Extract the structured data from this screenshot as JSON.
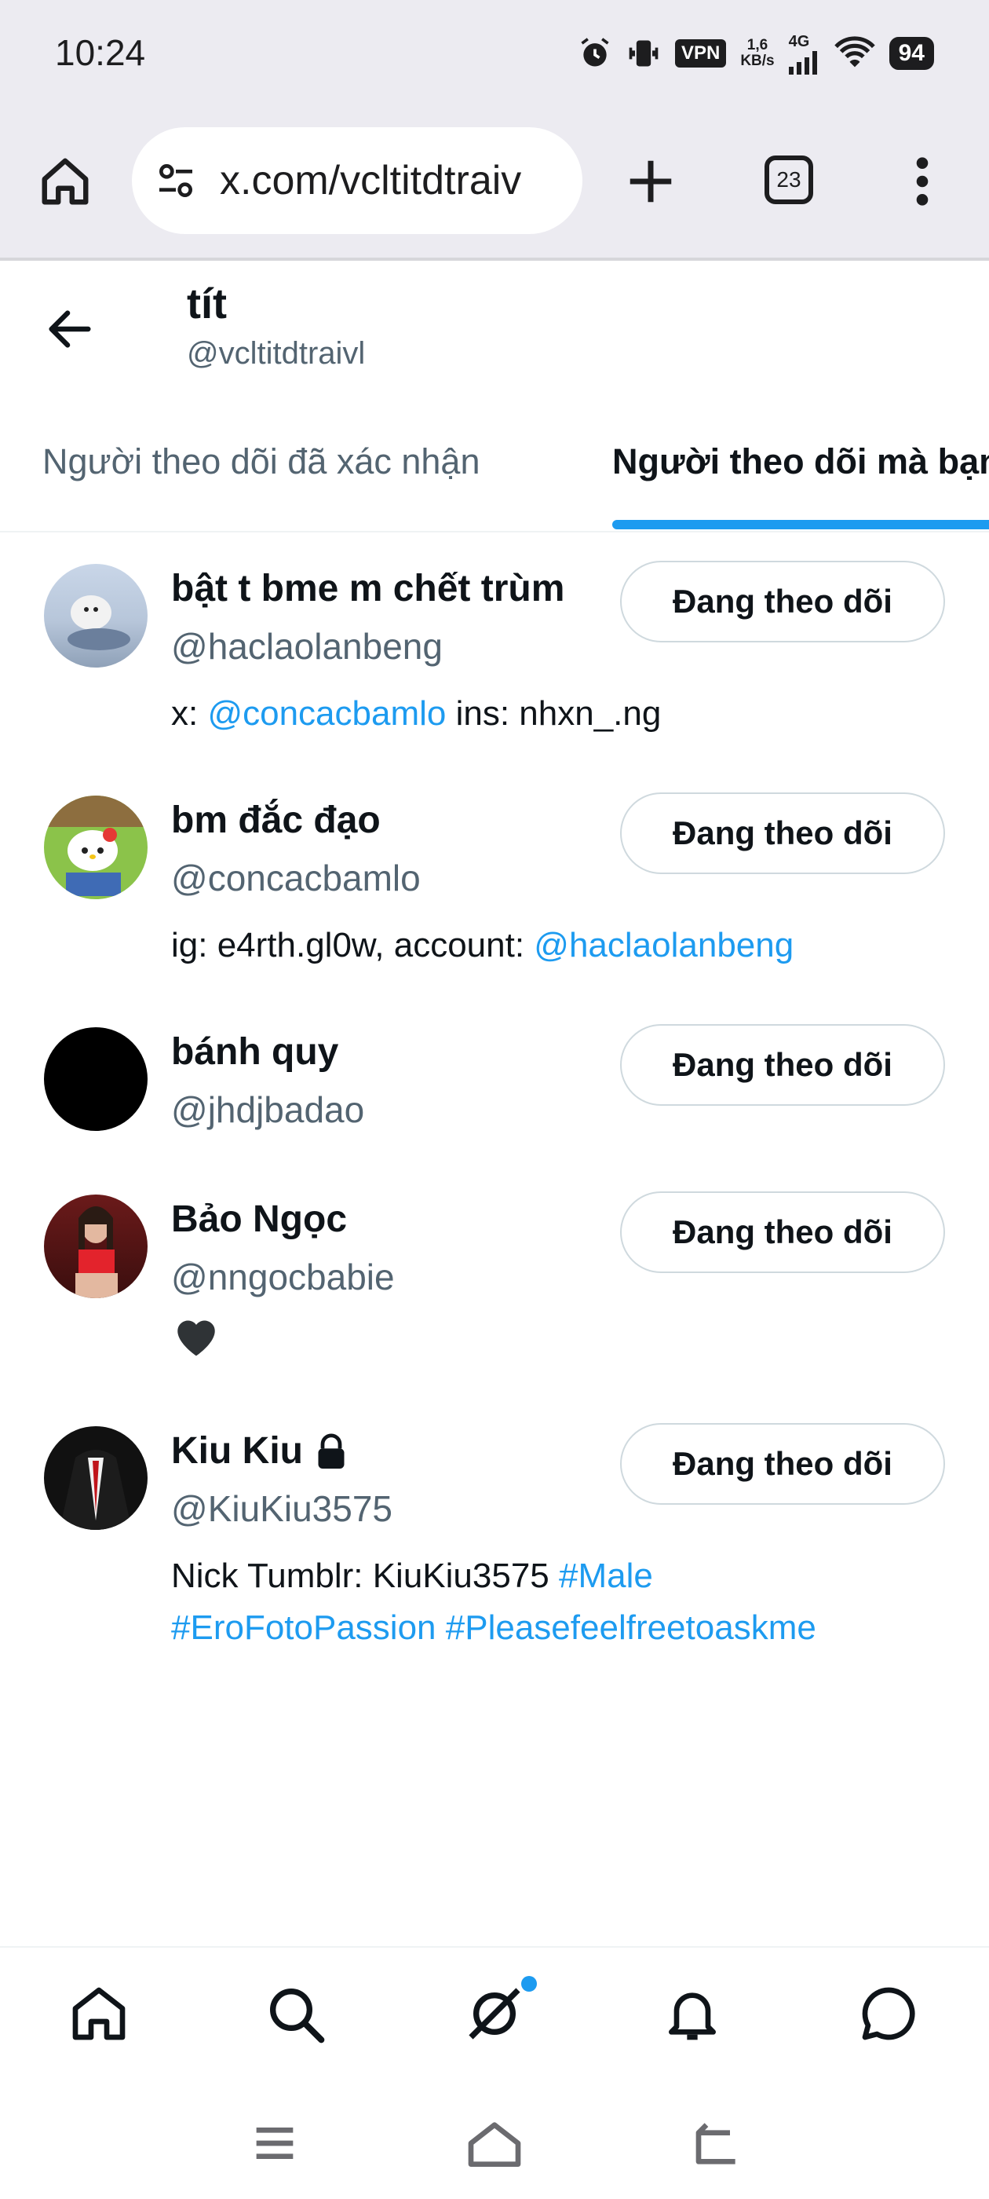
{
  "status_bar": {
    "time": "10:24",
    "vpn": "VPN",
    "speed_value": "1,6",
    "speed_unit": "KB/s",
    "network": "4G",
    "battery": "94"
  },
  "browser": {
    "url": "x.com/vcltitdtraiv",
    "tab_count": "23"
  },
  "profile": {
    "name": "tít",
    "handle": "@vcltitdtraivl"
  },
  "tabs": {
    "verified_followers": "Người theo dõi đã xác nhận",
    "known_followers": "Người theo dõi mà bạn biết"
  },
  "users": [
    {
      "name": "bật t bme m chết trùm",
      "handle": "@haclaolanbeng",
      "bio_1": "x: ",
      "bio_link_1": "@concacbamlo",
      "bio_2": " ins: nhxn_.ng",
      "button": "Đang theo dõi"
    },
    {
      "name": "bm đắc đạo",
      "handle": "@concacbamlo",
      "bio_1": "ig: e4rth.gl0w, account: ",
      "bio_link_1": "@haclaolanbeng",
      "button": "Đang theo dõi"
    },
    {
      "name": "bánh quy",
      "handle": "@jhdjbadao",
      "button": "Đang theo dõi"
    },
    {
      "name": "Bảo Ngọc",
      "handle": "@nngocbabie",
      "bio_1": "🖤",
      "button": "Đang theo dõi"
    },
    {
      "name": "Kiu Kiu",
      "handle": "@KiuKiu3575",
      "bio_1": "Nick Tumblr: KiuKiu3575 ",
      "bio_link_1": "#Male",
      "bio_link_2": "#EroFotoPassion",
      "bio_link_3": "#Pleasefeelfreetoaskme",
      "button": "Đang theo dõi"
    }
  ],
  "colors": {
    "accent": "#1d9bf0",
    "text_primary": "#0f1419",
    "text_secondary": "#536471",
    "chrome_bg": "#ecebf1"
  },
  "icons": {
    "bottom_nav": [
      "home-icon",
      "search-icon",
      "grok-icon",
      "notifications-icon",
      "messages-icon"
    ],
    "system_nav": [
      "recents-icon",
      "system-home-icon",
      "system-back-icon"
    ]
  }
}
